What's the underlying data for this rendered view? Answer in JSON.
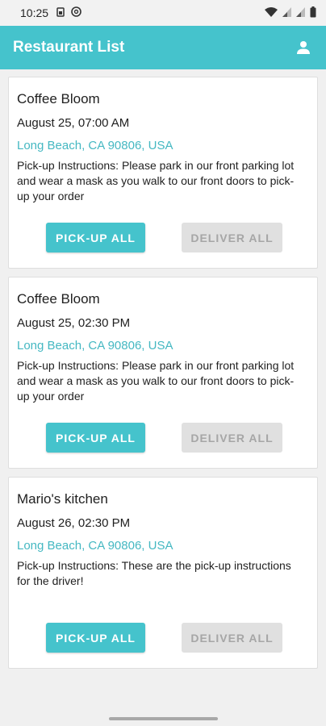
{
  "status_bar": {
    "time": "10:25",
    "left_icons": [
      "sim-icon",
      "at-icon"
    ],
    "right_icons": [
      "wifi-icon",
      "signal-icon",
      "signal-icon",
      "battery-icon"
    ]
  },
  "app_bar": {
    "title": "Restaurant List",
    "account_icon": "account-icon",
    "color": "#45c3cc"
  },
  "restaurants": [
    {
      "name": "Coffee Bloom",
      "date": "August 25, 07:00 AM",
      "address": "Long Beach, CA 90806, USA",
      "instructions": "Pick-up Instructions: Please park in our front parking lot and wear a mask as you walk to our front doors to pick-up your order",
      "pickup_label": "PICK-UP ALL",
      "deliver_label": "DELIVER ALL"
    },
    {
      "name": "Coffee Bloom",
      "date": "August 25, 02:30 PM",
      "address": "Long Beach, CA 90806, USA",
      "instructions": "Pick-up Instructions: Please park in our front parking lot and wear a mask as you walk to our front doors to pick-up your order",
      "pickup_label": "PICK-UP ALL",
      "deliver_label": "DELIVER ALL"
    },
    {
      "name": "Mario's kitchen",
      "date": "August 26, 02:30 PM",
      "address": "Long Beach, CA 90806, USA",
      "instructions": "Pick-up Instructions: These are the pick-up instructions for the driver!",
      "pickup_label": "PICK-UP ALL",
      "deliver_label": "DELIVER ALL"
    }
  ]
}
